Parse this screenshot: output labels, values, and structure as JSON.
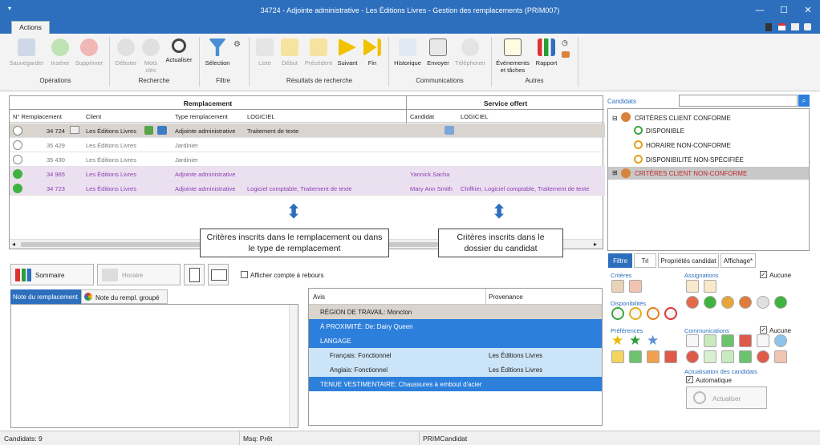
{
  "window": {
    "title": "34724 - Adjointe administrative - Les Éditions Livres - Gestion des remplacements (PRIM007)",
    "tab": "Actions"
  },
  "ribbon": {
    "save": "Sauvegarder",
    "insert": "Insérer",
    "delete": "Supprimer",
    "group_ops": "Opérations",
    "start": "Débuter",
    "keywords": "Mots clés",
    "refresh": "Actualiser",
    "group_search": "Recherche",
    "selection": "Sélection",
    "group_filter": "Filtre",
    "list": "Liste",
    "first": "Début",
    "prev": "Précédent",
    "next": "Suivant",
    "last": "Fin",
    "group_results": "Résultats de recherche",
    "history": "Historique",
    "send": "Envoyer",
    "phone": "Téléphoner",
    "group_comm": "Communications",
    "events": "Événements et tâches",
    "report": "Rapport",
    "group_other": "Autres"
  },
  "grid": {
    "group_repl": "Remplacement",
    "group_service": "Service offert",
    "cols": {
      "num": "N° Remplacement",
      "client": "Client",
      "type": "Type remplacement",
      "software": "LOGICIEL",
      "candidate": "Candidat",
      "software2": "LOGICIEL"
    },
    "rows": [
      {
        "num": "34 724",
        "client": "Les Éditions Livres",
        "type": "Adjointe administrative",
        "software": "Traitement de texte",
        "candidate": "",
        "software2": ""
      },
      {
        "num": "35 429",
        "client": "Les Éditions Livres",
        "type": "Jardinier",
        "software": "",
        "candidate": "",
        "software2": ""
      },
      {
        "num": "35 430",
        "client": "Les Éditions Livres",
        "type": "Jardinier",
        "software": "",
        "candidate": "",
        "software2": ""
      },
      {
        "num": "34 965",
        "client": "Les Éditions Livres",
        "type": "Adjointe administrative",
        "software": "",
        "candidate": "Yannick Sacha",
        "software2": ""
      },
      {
        "num": "34 723",
        "client": "Les Éditions Livres",
        "type": "Adjointe administrative",
        "software": "Logiciel comptable, Traitement de texte",
        "candidate": "Mary Ann Smith",
        "software2": "Chiffrier, Logiciel comptable, Traitement de texte"
      }
    ]
  },
  "callouts": {
    "left": "Critères inscrits dans le remplacement ou dans le type de remplacement",
    "right": "Critères inscrits dans le dossier du candidat"
  },
  "lower": {
    "summary": "Sommaire",
    "schedule": "Horaire",
    "countdown": "Afficher compte à rebours",
    "note_tab1": "Note du remplacement",
    "note_tab2": "Note du rempl. groupé"
  },
  "avis": {
    "col1": "Avis",
    "col2": "Provenance",
    "rows": [
      {
        "text": "RÉGION DE TRAVAIL: Moncton",
        "prov": ""
      },
      {
        "text": "À PROXIMITÉ: De: Dairy Queen",
        "prov": ""
      },
      {
        "text": "LANGAGE",
        "prov": ""
      },
      {
        "text": "Français: Fonctionnel",
        "prov": "Les Éditions Livres"
      },
      {
        "text": "Anglais: Fonctionnel",
        "prov": "Les Éditions Livres"
      },
      {
        "text": "TENUE VESTIMENTAIRE: Chaussures à embout d'acier",
        "prov": ""
      }
    ]
  },
  "candidates": {
    "label": "Candidats",
    "tree_conform": "CRITÈRES CLIENT CONFORME",
    "available": "DISPONIBLE",
    "schedule_nc": "HORAIRE NON-CONFORME",
    "avail_unspec": "DISPONIBILITÉ NON-SPÉCIFIÉE",
    "tree_nonconform": "CRITÈRES CLIENT NON-CONFORME"
  },
  "filters": {
    "tabs": [
      "Filtre",
      "Tri",
      "Propriétés candidat",
      "Affichage*"
    ],
    "criteria": "Critères",
    "assignments": "Assignations",
    "none": "Aucune",
    "availability": "Disponibilités",
    "preferences": "Préférences",
    "communications": "Communications",
    "none2": "Aucune",
    "refresh_section": "Actualisation des candidats",
    "automatic": "Automatique",
    "refresh_btn": "Actualiser"
  },
  "status": {
    "candidates": "Candidats: 9",
    "msg": "Msq: Prêt",
    "form": "PRIMCandidat"
  }
}
